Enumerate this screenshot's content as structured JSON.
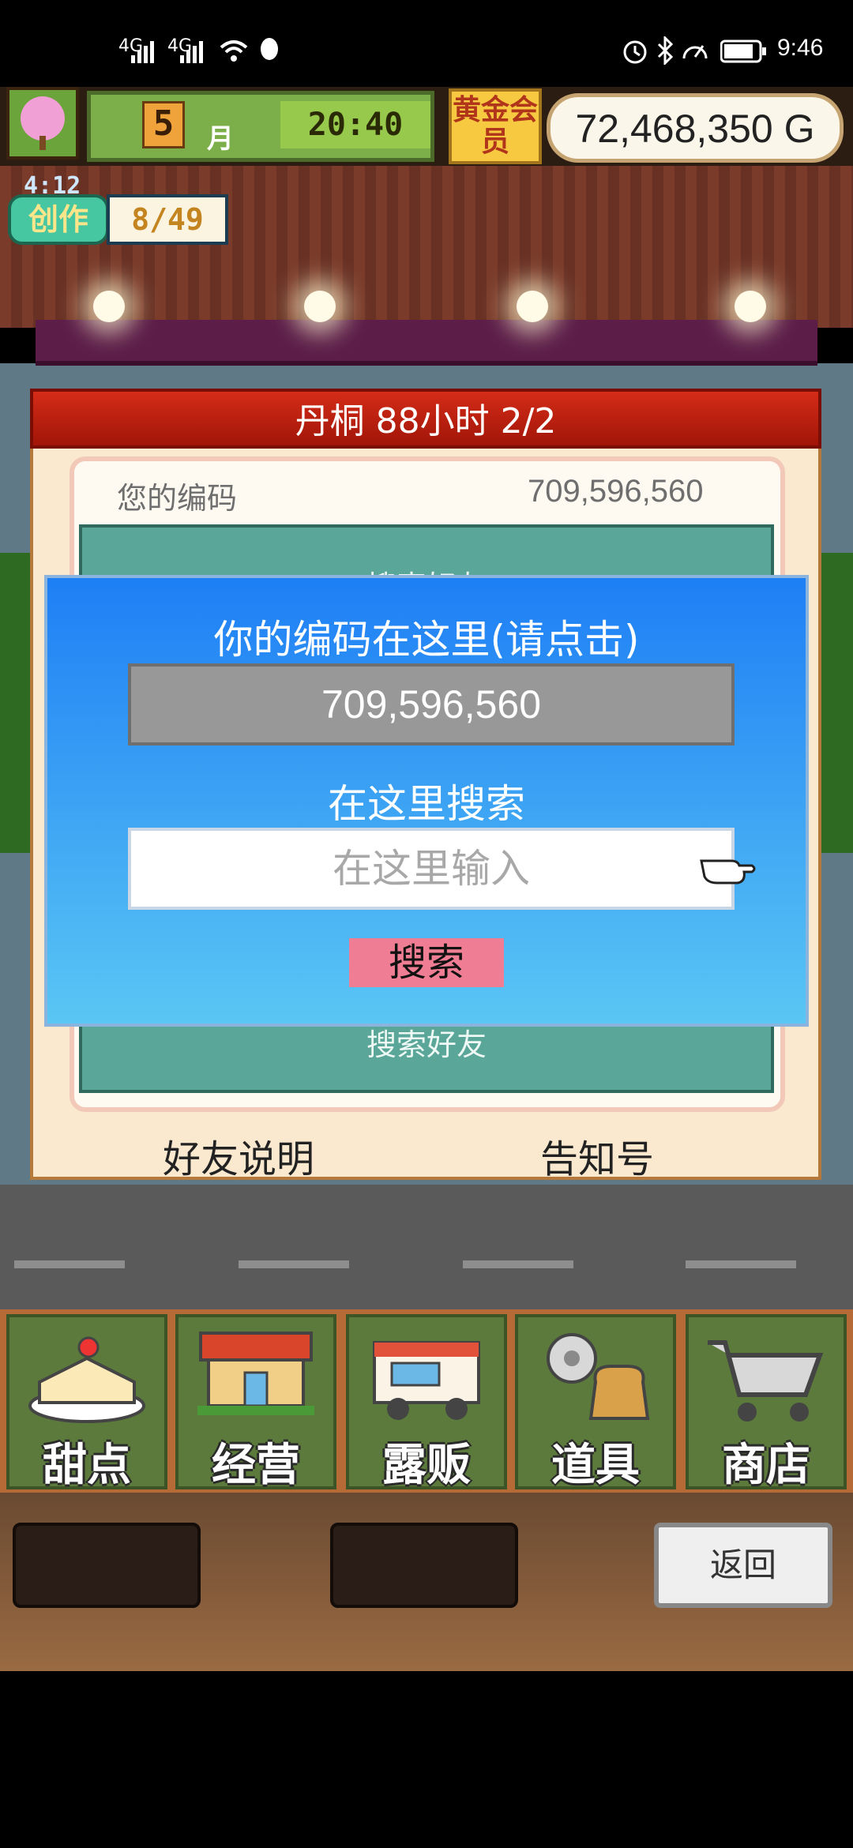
{
  "status_bar": {
    "signal_1": "4G",
    "signal_2": "4G",
    "time": "9:46"
  },
  "hud": {
    "month_number": "5",
    "month_label": "月",
    "clock": "20:40",
    "gold_member_label": "黄金会员",
    "money": "72,468,350 G",
    "create_timer": "4:12",
    "create_label": "创作",
    "create_count": "8/49"
  },
  "friends_panel": {
    "header": "丹桐  88小时 2/2",
    "code_label": "您的编码",
    "code_value": "709,596,560",
    "top_clip_text": "搜索好友",
    "search_friend_label": "搜索好友",
    "friend_explain": "好友说明",
    "notice_number": "告知号"
  },
  "code_dialog": {
    "title": "你的编码在这里(请点击)",
    "code": "709,596,560",
    "search_title": "在这里搜索",
    "search_placeholder": "在这里输入",
    "search_button": "搜索"
  },
  "menu": {
    "items": [
      {
        "label": "甜点",
        "icon": "cake-icon"
      },
      {
        "label": "经营",
        "icon": "shop-icon"
      },
      {
        "label": "露贩",
        "icon": "food-truck-icon"
      },
      {
        "label": "道具",
        "icon": "gear-bag-icon"
      },
      {
        "label": "商店",
        "icon": "cart-icon"
      }
    ]
  },
  "bottom_bar": {
    "back_label": "返回"
  }
}
